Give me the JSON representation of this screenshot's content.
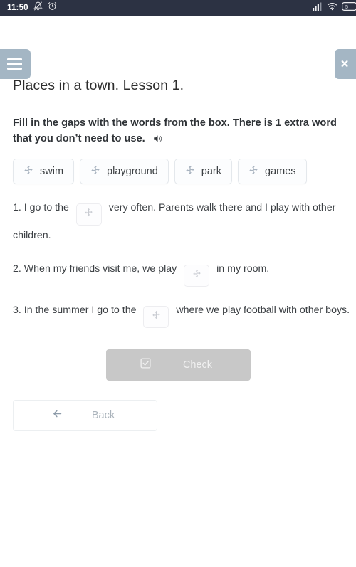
{
  "status_bar": {
    "time": "11:50",
    "left_icons": [
      "bell-muted-icon",
      "alarm-clock-icon"
    ],
    "right_icons": [
      "cellular-signal-icon",
      "wifi-icon",
      "battery-icon"
    ],
    "background_color": "#2c3243"
  },
  "header": {
    "menu_label": "menu-icon",
    "close_label": "×"
  },
  "lesson": {
    "title": "Places in a town. Lesson 1.",
    "instruction": "Fill in the gaps with the words from the box. There is 1 extra word that you don’t need to use.",
    "audio_icon": "speaker-icon"
  },
  "word_bank": {
    "chips": [
      {
        "label": "swim"
      },
      {
        "label": "playground"
      },
      {
        "label": "park"
      },
      {
        "label": "games"
      }
    ]
  },
  "questions": [
    {
      "number": "1.",
      "before": "1. I go to the",
      "after": "very often. Parents walk there and I play with other children.",
      "answer": ""
    },
    {
      "number": "2.",
      "before": "2. When my friends visit me, we play",
      "after": "in my room.",
      "answer": ""
    },
    {
      "number": "3.",
      "before": "3. In the summer I go to the",
      "after": "where we play football with other boys.",
      "answer": ""
    }
  ],
  "actions": {
    "check_label": "Check",
    "check_icon": "checkbox-checked-icon",
    "check_disabled": true,
    "back_label": "Back",
    "back_icon": "arrow-left-icon"
  },
  "colors": {
    "status_bar": "#2c3243",
    "header_button": "#a4b6c4",
    "check_disabled": "#c8c8c8",
    "text_primary": "#3b3f43",
    "chip_border": "#e4e8ec"
  }
}
